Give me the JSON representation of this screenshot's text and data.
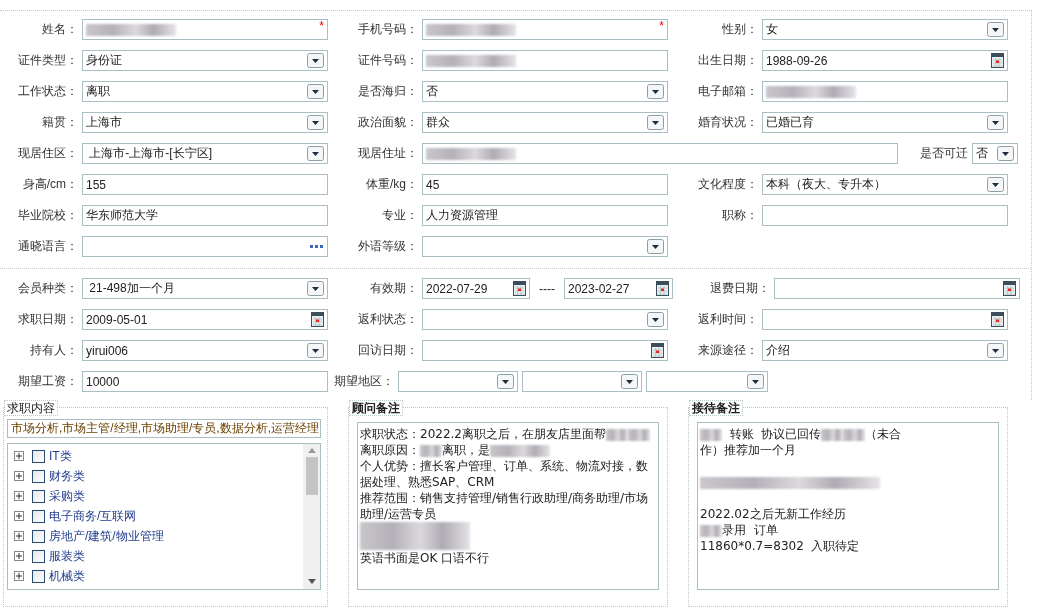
{
  "sections": [
    {
      "rows": [
        [
          {
            "label": "姓名：",
            "kind": "text",
            "blurred": true,
            "marker": "*"
          },
          {
            "label": "手机号码：",
            "kind": "text",
            "blurred": true,
            "marker": "*"
          },
          {
            "label": "性别：",
            "kind": "select",
            "value": "女"
          }
        ],
        [
          {
            "label": "证件类型：",
            "kind": "select",
            "value": "身份证"
          },
          {
            "label": "证件号码：",
            "kind": "text",
            "blurred": true
          },
          {
            "label": "出生日期：",
            "kind": "date",
            "value": "1988-09-26"
          }
        ],
        [
          {
            "label": "工作状态：",
            "kind": "select",
            "value": "离职"
          },
          {
            "label": "是否海归：",
            "kind": "select",
            "value": "否"
          },
          {
            "label": "电子邮箱：",
            "kind": "text",
            "blurred": true
          }
        ],
        [
          {
            "label": "籍贯：",
            "kind": "select",
            "value": "上海市"
          },
          {
            "label": "政治面貌：",
            "kind": "select",
            "value": "群众"
          },
          {
            "label": "婚育状况：",
            "kind": "select",
            "value": "已婚已育"
          }
        ],
        [
          {
            "label": "现居住区：",
            "kind": "select",
            "value": " 上海市-上海市-[长宁区]"
          },
          {
            "label": "现居住址：",
            "kind": "wide",
            "blurred": true
          },
          {
            "label": "是否可迁",
            "kind": "mini",
            "value": "否"
          }
        ],
        [
          {
            "label": "身高/cm：",
            "kind": "text",
            "value": "155"
          },
          {
            "label": "体重/kg：",
            "kind": "text",
            "value": "45"
          },
          {
            "label": "文化程度：",
            "kind": "select",
            "value": "本科（夜大、专升本）"
          }
        ],
        [
          {
            "label": "毕业院校：",
            "kind": "text",
            "value": "华东师范大学"
          },
          {
            "label": "专业：",
            "kind": "text",
            "value": "人力资源管理"
          },
          {
            "label": "职称：",
            "kind": "text"
          }
        ],
        [
          {
            "label": "通晓语言：",
            "kind": "lookup"
          },
          {
            "label": "外语等级：",
            "kind": "select"
          }
        ]
      ]
    },
    {
      "rows": [
        [
          {
            "label": "会员种类：",
            "kind": "select",
            "value": " 21-498加一个月"
          },
          {
            "label": "有效期：",
            "kind": "range",
            "value": "2022-07-29",
            "separator": "----",
            "value_end": "2023-02-27"
          },
          {
            "label": "退费日期：",
            "kind": "date"
          }
        ],
        [
          {
            "label": "求职日期：",
            "kind": "date",
            "value": "2009-05-01"
          },
          {
            "label": "返利状态：",
            "kind": "select"
          },
          {
            "label": "返利时间：",
            "kind": "date"
          }
        ],
        [
          {
            "label": "持有人：",
            "kind": "select",
            "value": "yirui006"
          },
          {
            "label": "回访日期：",
            "kind": "date"
          },
          {
            "label": "来源途径：",
            "kind": "select",
            "value": "介绍"
          }
        ],
        [
          {
            "label": "期望工资：",
            "kind": "text",
            "value": "10000"
          },
          {
            "label": "期望地区：",
            "kind": "multi"
          }
        ]
      ]
    }
  ],
  "job_content": {
    "legend": "求职内容",
    "value": "市场分析,市场主管/经理,市场助理/专员,数据分析,运营经理",
    "tree": [
      {
        "label": "IT类",
        "checked": false,
        "expanded": false
      },
      {
        "label": "财务类",
        "checked": false,
        "expanded": false
      },
      {
        "label": "采购类",
        "checked": false,
        "expanded": false
      },
      {
        "label": "电子商务/互联网",
        "checked": false,
        "expanded": false
      },
      {
        "label": "房地产/建筑/物业管理",
        "checked": false,
        "expanded": false
      },
      {
        "label": "服装类",
        "checked": false,
        "expanded": false
      },
      {
        "label": "机械类",
        "checked": false,
        "expanded": false
      }
    ]
  },
  "notes": [
    {
      "legend": "顾问备注",
      "paragraphs": [
        [
          {
            "text": "求职状态：2022.2离职之后，在朋友店里面帮"
          },
          {
            "kind": "blur"
          },
          {
            "kind": "blur"
          }
        ],
        [
          {
            "text": "离职原因："
          },
          {
            "kind": "blur"
          },
          {
            "text": "离职，是"
          },
          {
            "kind": "blur_wide"
          }
        ],
        [
          {
            "text": "个人优势：擅长客户管理、订单、系统、物流对接，数据处理、熟悉SAP、CRM"
          }
        ],
        [
          {
            "text": "推荐范围：销售支持管理/销售行政助理/商务助理/市场助理/运营专员"
          }
        ],
        [
          {
            "kind": "blur_block"
          }
        ],
        [
          {
            "text": "英语书面是OK 口语不行"
          }
        ]
      ]
    },
    {
      "legend": "接待备注",
      "paragraphs": [
        [
          {
            "kind": "blur"
          },
          {
            "text": "  转账  协议已回传"
          },
          {
            "kind": "blur"
          },
          {
            "kind": "blur"
          },
          {
            "text": "（未合"
          },
          {
            "text": "作）推荐加一个月"
          }
        ],
        [
          {
            "kind": "blur_line"
          }
        ],
        [
          {
            "text": "2022.02之后无新工作经历"
          }
        ],
        [
          {
            "kind": "blur"
          },
          {
            "text": "录用  订单"
          }
        ],
        [
          {
            "text": "11860*0.7=8302  入职待定"
          }
        ]
      ]
    }
  ]
}
